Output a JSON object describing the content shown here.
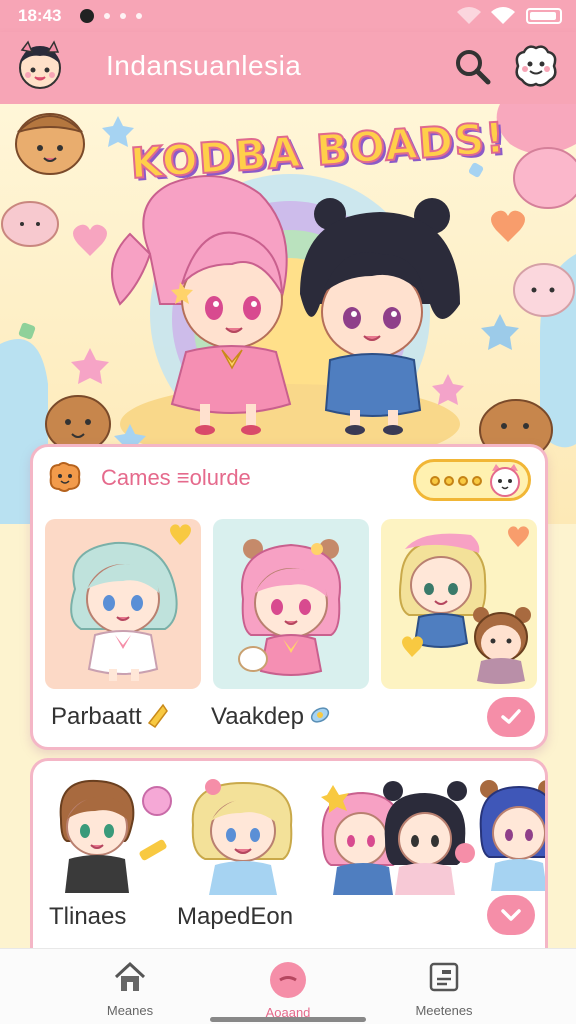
{
  "status_bar": {
    "time": "18:43"
  },
  "app_bar": {
    "title": "Indansuanlesia"
  },
  "hero": {
    "title": "KODBA BOADS!"
  },
  "games_section": {
    "title": "Cames ≡olurde",
    "tiles": [
      {
        "label": "Parbaatt"
      },
      {
        "label": "Vaakdep"
      },
      {
        "label": ""
      }
    ]
  },
  "second_section": {
    "labels": [
      "Tlinaes",
      "MapedEon"
    ]
  },
  "bottom_nav": [
    {
      "label": "Meanes",
      "icon": "house-icon"
    },
    {
      "label": "Aoaand",
      "icon": "heart-circle-icon",
      "active": true
    },
    {
      "label": "Meetenes",
      "icon": "document-icon"
    }
  ],
  "colors": {
    "accent": "#f7a5b6",
    "button": "#f58ea8",
    "title_text": "#e56a8c"
  }
}
